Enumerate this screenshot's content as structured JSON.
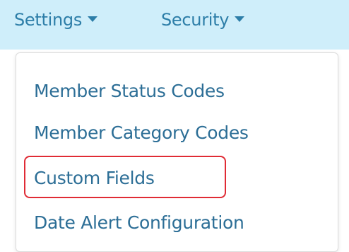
{
  "navbar": {
    "items": [
      {
        "label": "Settings"
      },
      {
        "label": "Security"
      }
    ]
  },
  "dropdown": {
    "items": [
      {
        "label": "Member Status Codes"
      },
      {
        "label": "Member Category Codes"
      },
      {
        "label": "Custom Fields"
      },
      {
        "label": "Date Alert Configuration"
      }
    ],
    "highlighted_item": "Custom Fields"
  },
  "colors": {
    "navbar_bg": "#cfeefa",
    "link": "#2d7ea8",
    "highlight": "#e02b35"
  }
}
